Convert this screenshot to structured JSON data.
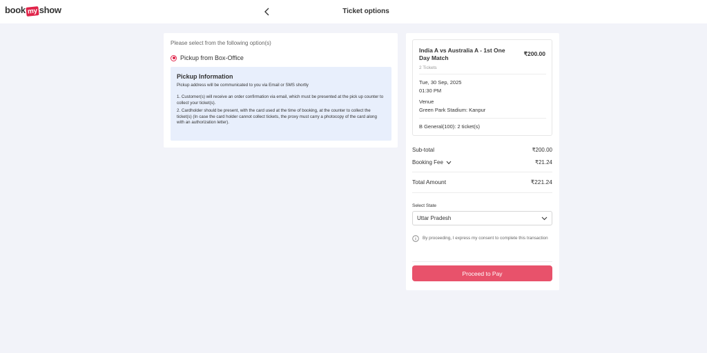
{
  "header": {
    "logo_part1": "book",
    "logo_part2": "my",
    "logo_part3": "show",
    "title": "Ticket options",
    "back_icon": "chevron-left-icon"
  },
  "options": {
    "prompt": "Please select from the following option(s)",
    "selected_option": "Pickup from Box-Office",
    "info_title": "Pickup Information",
    "info_subtitle": "Pickup address will be communicated to you via Email or SMS shortly",
    "info_points": [
      "1. Customer(s) will receive an order confirmation via email, which must be presented at the pick up counter to collect your ticket(s).",
      "2. Cardholder should be present, with the card used at the time of booking, at the counter to collect the ticket(s) (In case the card holder cannot collect tickets, the proxy must carry a photocopy of the card along with an authorization letter)."
    ]
  },
  "summary": {
    "event_title": "India A vs Australia A - 1st One Day Match",
    "event_price": "₹200.00",
    "ticket_count": "2 Tickets",
    "date": "Tue, 30 Sep, 2025",
    "time": "01:30 PM",
    "venue_label": "Venue",
    "venue": "Green Park Stadium: Kanpur",
    "seats": "B General(100): 2 ticket(s)",
    "subtotal_label": "Sub-total",
    "subtotal_value": "₹200.00",
    "fee_label": "Booking Fee",
    "fee_value": "₹21.24",
    "total_label": "Total Amount",
    "total_value": "₹221.24",
    "state_label": "Select State",
    "state_value": "Uttar Pradesh",
    "consent": "By proceeding, I express my consent to complete this transaction",
    "pay_label": "Proceed to Pay"
  },
  "colors": {
    "brand": "#e0244a",
    "pay_button": "#e8526b",
    "info_box": "#e8effc",
    "background": "#f2f3f9"
  }
}
